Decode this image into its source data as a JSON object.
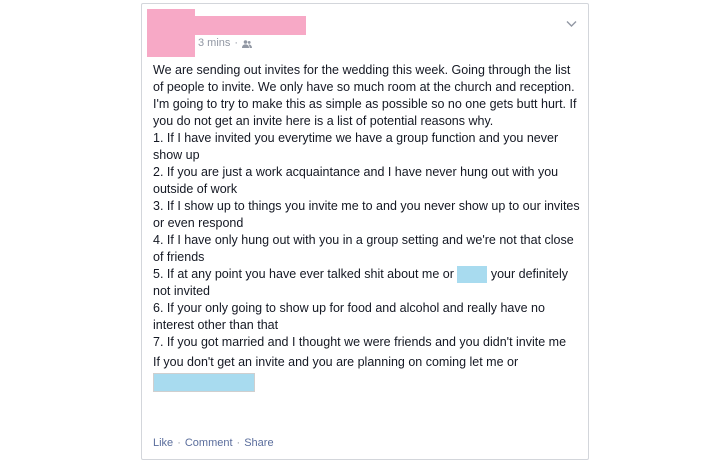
{
  "header": {
    "timestamp": "3 mins",
    "separator": "·",
    "audience_icon": "friends-icon",
    "menu_icon": "chevron-down-icon"
  },
  "post": {
    "intro": "We are sending out invites for the wedding this week. Going through the list of people to invite. We only have so much room at the church and reception. I'm going to try to make this as simple as possible so no one gets butt hurt. If you do not get an invite here is a list of potential reasons why.",
    "items": [
      "1. If I have invited you everytime we have a group function and you never show up",
      "2. If you are just a work acquaintance and I have never hung out with you outside of work",
      "3. If I show up to things you invite me to and you never show up to our invites or even respond",
      "4. If I have only hung out with you in a group setting and we're not that close of friends",
      "5. If at any point you have ever talked shit about me or",
      "6. If your only going to show up for food and alcohol and really have no interest other than that",
      "7. If you got married and I thought we were friends and you didn't invite me"
    ],
    "item5_tail": "your definitely not invited",
    "closing": "If you don't get an invite and you are planning on coming let me or"
  },
  "actions": {
    "like": "Like",
    "comment": "Comment",
    "share": "Share",
    "separator": "·"
  },
  "colors": {
    "pink_redaction": "#f7a9c6",
    "blue_redaction": "#a8dbef",
    "link": "#5a6d9c"
  }
}
